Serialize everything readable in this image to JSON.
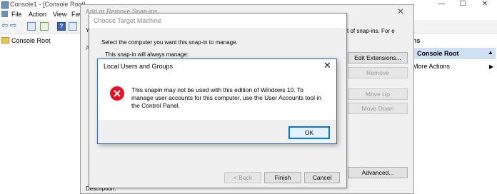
{
  "main_window": {
    "title": "Console1 - [Console Root]",
    "controls": {
      "minimize": "—",
      "maximize": "☐",
      "close": "✕"
    },
    "menu": [
      "File",
      "Action",
      "View",
      "Fav"
    ],
    "tree": {
      "root": "Console Root"
    },
    "actions": {
      "header": "ns",
      "selected": "Console Root",
      "more": "More Actions"
    }
  },
  "snapin_dialog": {
    "title": "Add or Remove Snap-ins",
    "left_char": "Y",
    "label_a": "A",
    "right_text": "t of snap-ins. For e",
    "buttons": {
      "edit_extensions": "Edit Extensions...",
      "remove": "Remove",
      "move_up": "Move Up",
      "move_down": "Move Down",
      "advanced": "Advanced..."
    },
    "description_label": "Description:"
  },
  "choose_target": {
    "title": "Choose Target Machine",
    "instruction": "Select the computer you want this snap-in to manage.",
    "subtext": "This snap-in will always manage:",
    "buttons": {
      "back": "< Back",
      "finish": "Finish",
      "cancel": "Cancel"
    }
  },
  "message_box": {
    "title": "Local Users and Groups",
    "close": "✕",
    "icon": "error-icon",
    "message": "This snapin may not be used with this edition of Windows 10. To manage user accounts for this computer, use the User Accounts tool in the Control Panel.",
    "ok_label": "OK"
  },
  "colors": {
    "accent": "#0078d7",
    "error": "#e81123",
    "selection": "#cfe0f4"
  }
}
